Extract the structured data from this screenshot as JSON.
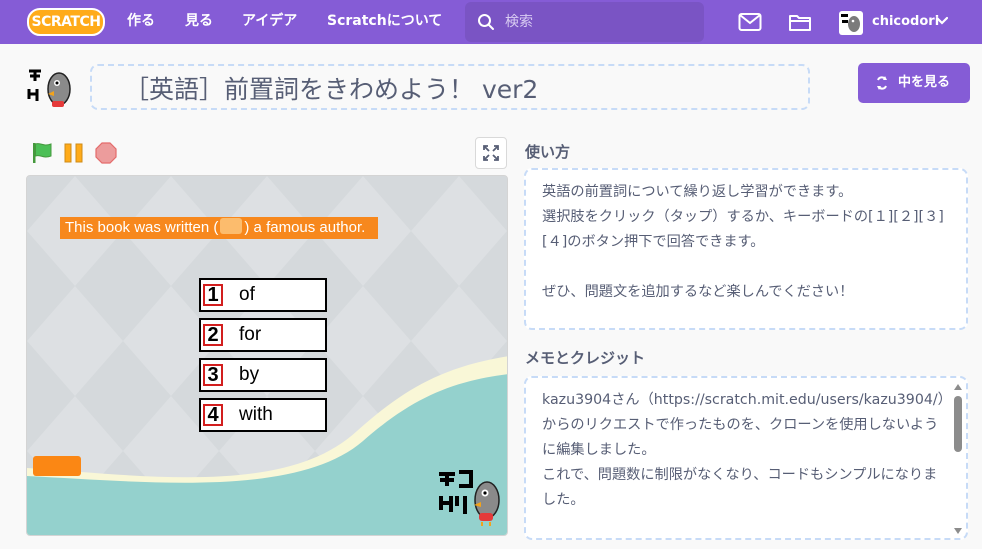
{
  "nav": {
    "logo": "SCRATCH",
    "links": [
      "作る",
      "見る",
      "アイデア",
      "Scratchについて"
    ],
    "search_placeholder": "検索",
    "username": "chicodori"
  },
  "project": {
    "title": "［英語］前置詞をきわめよう！ ver2",
    "see_inside": "中を見る"
  },
  "stage": {
    "question_before": "This book was written (",
    "question_after": ") a famous author.",
    "choices": [
      {
        "num": "1",
        "word": "of"
      },
      {
        "num": "2",
        "word": "for"
      },
      {
        "num": "3",
        "word": "by"
      },
      {
        "num": "4",
        "word": "with"
      }
    ]
  },
  "instructions": {
    "heading": "使い方",
    "lines": [
      "英語の前置詞について繰り返し学習ができます。",
      "選択肢をクリック（タップ）するか、キーボードの[１][２][３][４]のボタン押下で回答できます。",
      "ぜひ、問題文を追加するなど楽しんでください！"
    ]
  },
  "credits": {
    "heading": "メモとクレジット",
    "lines": [
      "kazu3904さん（https://scratch.mit.edu/users/kazu3904/）からのリクエストで作ったものを、クローンを使用しないように編集しました。",
      "これで、問題数に制限がなくなり、コードもシンプルになりました。"
    ]
  },
  "colors": {
    "nav": "#855cd6",
    "accent": "#855cd6",
    "logo": "#ffab19",
    "question_bg": "#f7881d",
    "stage_wave": "#94d1cd"
  }
}
